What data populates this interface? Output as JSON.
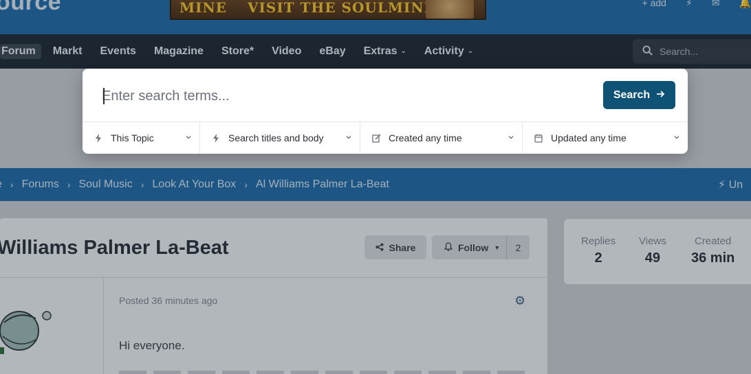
{
  "header": {
    "brand": "ource",
    "banner_words": [
      "MINE",
      "VISIT THE SOULMINE"
    ],
    "right_labels": [
      "+ add",
      "⚡",
      "✉",
      "🔔"
    ]
  },
  "nav": {
    "items": [
      {
        "label": "Forum",
        "active": true,
        "dropdown": false
      },
      {
        "label": "Markt",
        "active": false,
        "dropdown": false
      },
      {
        "label": "Events",
        "active": false,
        "dropdown": false
      },
      {
        "label": "Magazine",
        "active": false,
        "dropdown": false
      },
      {
        "label": "Store*",
        "active": false,
        "dropdown": false
      },
      {
        "label": "Video",
        "active": false,
        "dropdown": false
      },
      {
        "label": "eBay",
        "active": false,
        "dropdown": false
      },
      {
        "label": "Extras",
        "active": false,
        "dropdown": true
      },
      {
        "label": "Activity",
        "active": false,
        "dropdown": true
      }
    ],
    "search_placeholder": "Search..."
  },
  "search_modal": {
    "input_placeholder": "Enter search terms...",
    "input_value": "",
    "submit_label": "Search",
    "filters": [
      {
        "label": "This Topic",
        "icon": "bolt-icon"
      },
      {
        "label": "Search titles and body",
        "icon": "bolt-icon"
      },
      {
        "label": "Created any time",
        "icon": "edit-icon"
      },
      {
        "label": "Updated any time",
        "icon": "calendar-icon"
      }
    ]
  },
  "breadcrumb": {
    "items": [
      "e",
      "Forums",
      "Soul Music",
      "Look At Your Box",
      "Al Williams Palmer La-Beat"
    ],
    "right_label": "Un"
  },
  "topic": {
    "title": "Williams Palmer La-Beat",
    "share_label": "Share",
    "follow_label": "Follow",
    "follow_count": "2",
    "posted": "Posted 36 minutes ago",
    "body_first_line": "Hi everyone."
  },
  "stats": {
    "replies_label": "Replies",
    "replies_value": "2",
    "views_label": "Views",
    "views_value": "49",
    "created_label": "Created",
    "created_value": "36 min"
  },
  "colors": {
    "accent": "#0e5375",
    "header": "#1f6aa6",
    "nav": "#1c2733"
  }
}
